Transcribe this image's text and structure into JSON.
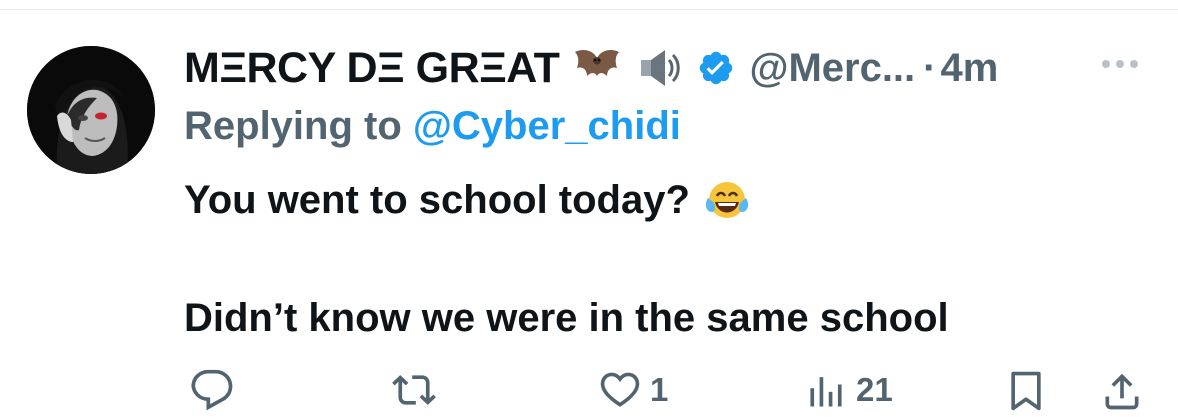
{
  "tweet": {
    "author": {
      "display_name": "MΞRCY DΞ GRΞAT",
      "handle": "@Merc...",
      "verified": true,
      "emojis": [
        "bat-emoji",
        "speaker-emoji"
      ]
    },
    "separator": "·",
    "timestamp": "4m",
    "reply_prefix": "Replying to",
    "reply_to": "@Cyber_chidi",
    "text_line_1": "You went to school today?",
    "text_emoji": "face-with-tears-of-joy-emoji",
    "text_line_2": "Didn’t know we were in the same school"
  },
  "actions": {
    "reply_icon": "reply-icon",
    "retweet_icon": "retweet-icon",
    "like_icon": "heart-icon",
    "like_count": "1",
    "views_icon": "views-icon",
    "views_count": "21",
    "bookmark_icon": "bookmark-icon",
    "share_icon": "share-icon"
  },
  "colors": {
    "text": "#0f1419",
    "secondary": "#536471",
    "link": "#1d9bf0",
    "verified": "#1d9bf0"
  }
}
